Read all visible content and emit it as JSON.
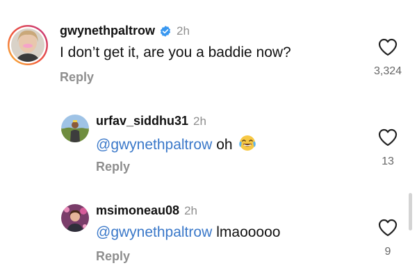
{
  "comments": [
    {
      "username": "gwynethpaltrow",
      "verified": true,
      "time": "2h",
      "text": "I don’t get it, are you a baddie now?",
      "reply_label": "Reply",
      "likes": "3,324",
      "avatar_icon": "profile-photo-story-ring"
    },
    {
      "username": "urfav_siddhu31",
      "time": "2h",
      "mention": "@gwynethpaltrow",
      "text": "oh",
      "emoji": "face-with-tears-of-joy",
      "reply_label": "Reply",
      "likes": "13",
      "avatar_icon": "profile-photo"
    },
    {
      "username": "msimoneau08",
      "time": "2h",
      "mention": "@gwynethpaltrow",
      "text": "lmaooooo",
      "reply_label": "Reply",
      "likes": "9",
      "avatar_icon": "profile-photo"
    }
  ],
  "colors": {
    "mention": "#3a78c9",
    "verified_badge": "#3897f0",
    "secondary_text": "#8e8e8e"
  }
}
